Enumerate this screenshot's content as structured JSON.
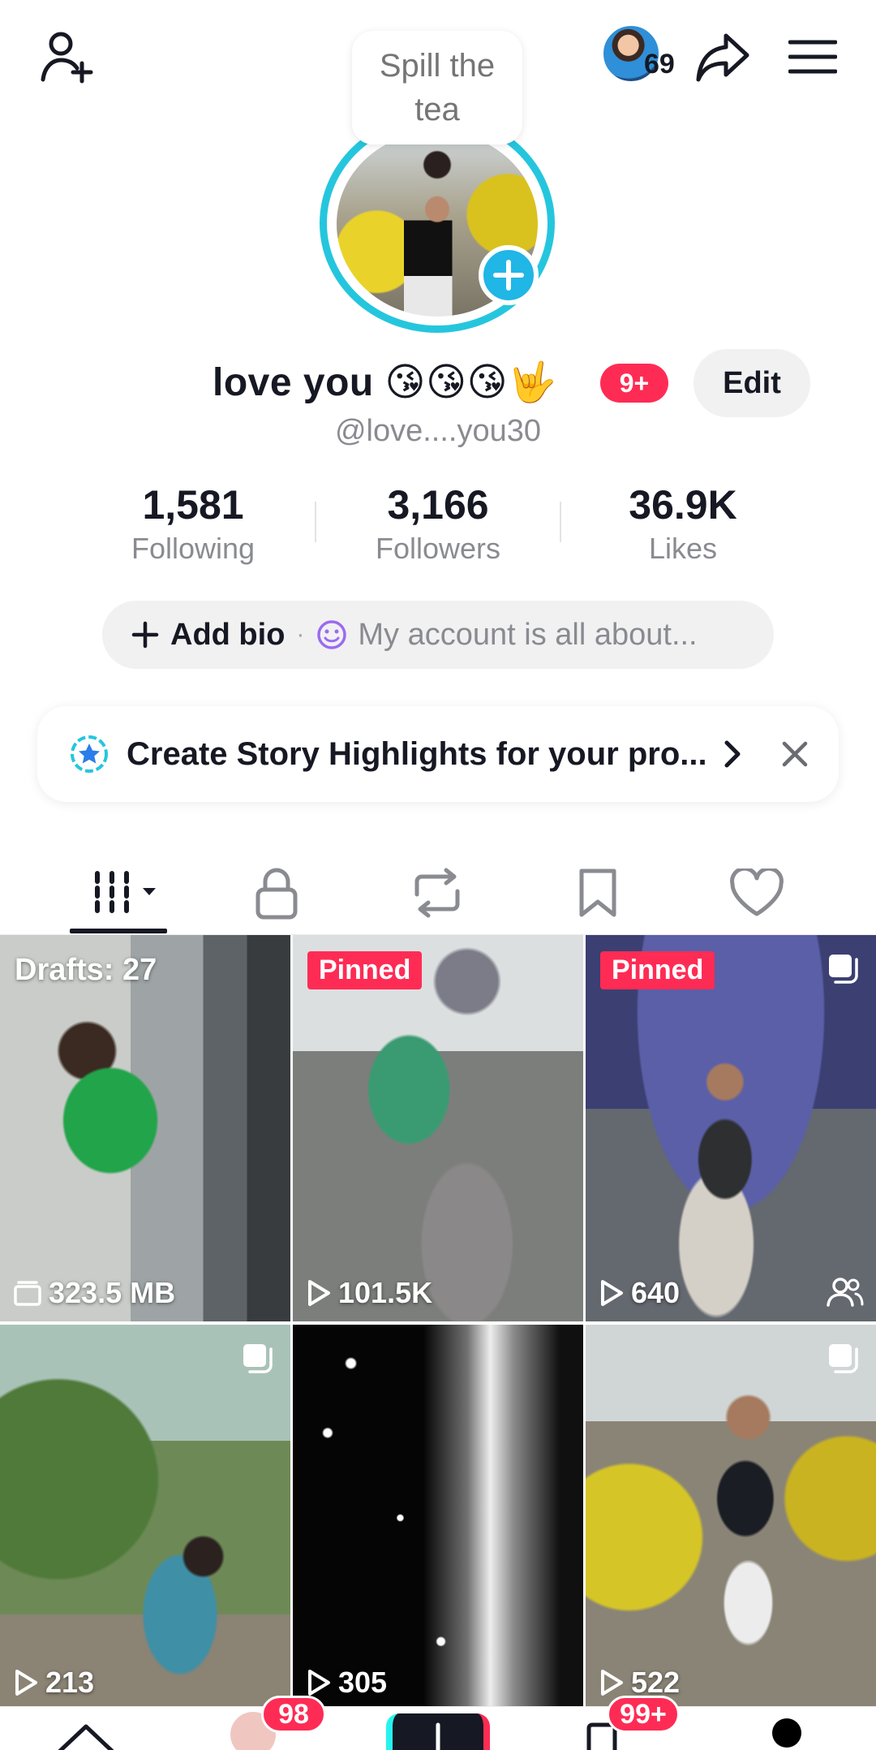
{
  "header": {
    "add_friend_icon": "person-plus-icon",
    "friend_count": "69",
    "share_icon": "share-arrow-icon",
    "menu_icon": "hamburger-menu-icon"
  },
  "profile": {
    "bubble_text": "Spill the tea",
    "display_name": "love you 😘😘😘🤟",
    "notification_badge": "9+",
    "edit_label": "Edit",
    "username": "@love....you30"
  },
  "stats": [
    {
      "value": "1,581",
      "label": "Following"
    },
    {
      "value": "3,166",
      "label": "Followers"
    },
    {
      "value": "36.9K",
      "label": "Likes"
    }
  ],
  "bio": {
    "add_label": "Add bio",
    "separator": "·",
    "placeholder": "My account is all about..."
  },
  "banner": {
    "text": "Create Story Highlights for your pro...",
    "icon": "star-highlight-icon"
  },
  "tabs": [
    {
      "name": "videos",
      "icon": "grid-dropdown-icon",
      "active": true
    },
    {
      "name": "private",
      "icon": "lock-icon"
    },
    {
      "name": "reposts",
      "icon": "repost-icon"
    },
    {
      "name": "favorites",
      "icon": "bookmark-icon"
    },
    {
      "name": "liked",
      "icon": "heart-icon"
    }
  ],
  "grid": [
    {
      "overlay": "Drafts: 27",
      "stat": "323.5 MB",
      "stat_icon": "drafts-stack-icon"
    },
    {
      "tag": "Pinned",
      "stat": "101.5K",
      "stat_icon": "play-icon"
    },
    {
      "tag": "Pinned",
      "stat": "640",
      "stat_icon": "play-icon",
      "multi": true,
      "friends_only": true
    },
    {
      "stat": "213",
      "stat_icon": "play-icon",
      "multi": true
    },
    {
      "stat": "305",
      "stat_icon": "play-icon"
    },
    {
      "stat": "522",
      "stat_icon": "play-icon",
      "multi": true
    }
  ],
  "bottom_nav": {
    "friends_badge": "98",
    "inbox_badge": "99+"
  },
  "colors": {
    "accent": "#fe2c55",
    "ring": "#25c6dd",
    "text": "#161823",
    "muted": "#8a8b91"
  }
}
